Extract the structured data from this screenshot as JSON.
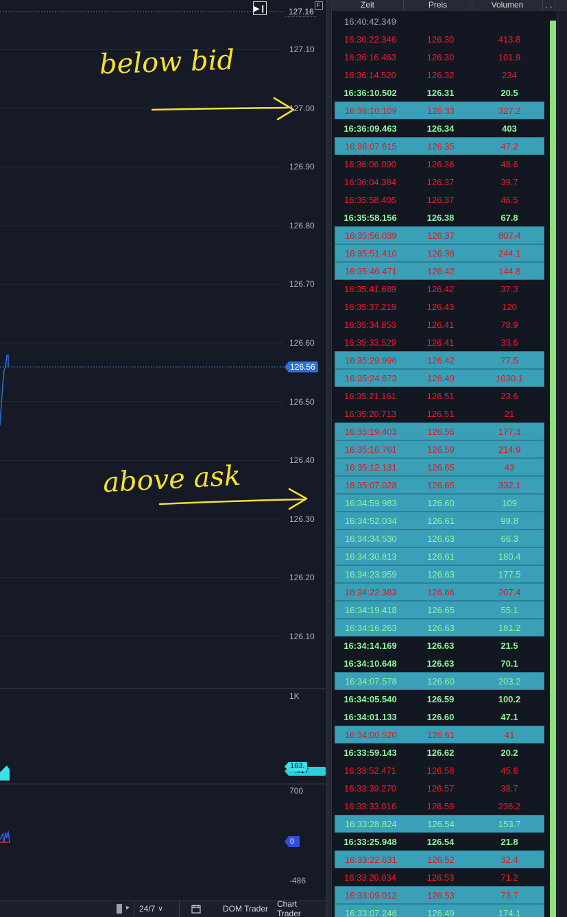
{
  "chart": {
    "price_axis": [
      "127.10",
      "127.00",
      "126.90",
      "126.80",
      "126.70",
      "126.60",
      "126.50",
      "126.40",
      "126.30",
      "126.20",
      "126.10"
    ],
    "high_price": "127.16",
    "last_price": "126.56",
    "indicator_axis": {
      "top": "1K",
      "mid": "700",
      "bottom": "-486"
    },
    "indicator_tag1": "163.",
    "indicator_tag2": ".517",
    "indicator_tag3": "0",
    "annotations": {
      "below_bid": "below bid",
      "above_ask": "above ask"
    },
    "colors": {
      "background": "#151a26",
      "grid": "#262b37",
      "price_line": "#2f6fd8",
      "annotation": "#f5e130"
    }
  },
  "toolbar": {
    "session": "24/7",
    "calendar_icon": "calendar-icon",
    "dom_trader": "DOM Trader",
    "chart_trader": "Chart Trader"
  },
  "tas": {
    "headers": {
      "time": "Zeit",
      "price": "Preis",
      "volume": "Volumen",
      "more": ". ."
    },
    "rows": [
      {
        "t": "16:40:42.349",
        "p": "",
        "v": "",
        "s": "gray"
      },
      {
        "t": "16:36:22.346",
        "p": "126.30",
        "v": "413.8",
        "s": "red"
      },
      {
        "t": "16:36:16.463",
        "p": "126.30",
        "v": "101.9",
        "s": "red"
      },
      {
        "t": "16:36:14.520",
        "p": "126.32",
        "v": "234",
        "s": "red"
      },
      {
        "t": "16:36:10.502",
        "p": "126.31",
        "v": "20.5",
        "s": "gb"
      },
      {
        "t": "16:36:10.109",
        "p": "126.33",
        "v": "327.2",
        "s": "red",
        "hl": true
      },
      {
        "t": "16:36:09.463",
        "p": "126.34",
        "v": "403",
        "s": "gb"
      },
      {
        "t": "16:36:07.615",
        "p": "126.35",
        "v": "47.2",
        "s": "red",
        "hl": true
      },
      {
        "t": "16:36:06.090",
        "p": "126.36",
        "v": "48.6",
        "s": "red"
      },
      {
        "t": "16:36:04.384",
        "p": "126.37",
        "v": "39.7",
        "s": "red"
      },
      {
        "t": "16:35:58.405",
        "p": "126.37",
        "v": "46.5",
        "s": "red"
      },
      {
        "t": "16:35:58.156",
        "p": "126.38",
        "v": "67.8",
        "s": "gb"
      },
      {
        "t": "16:35:56.039",
        "p": "126.37",
        "v": "807.4",
        "s": "red",
        "hl": true
      },
      {
        "t": "16:35:51.410",
        "p": "126.38",
        "v": "244.1",
        "s": "red",
        "hl": true
      },
      {
        "t": "16:35:46.471",
        "p": "126.42",
        "v": "144.8",
        "s": "red",
        "hl": true
      },
      {
        "t": "16:35:41.689",
        "p": "126.42",
        "v": "37.3",
        "s": "red"
      },
      {
        "t": "16:35:37.219",
        "p": "126.43",
        "v": "120",
        "s": "red"
      },
      {
        "t": "16:35:34.853",
        "p": "126.41",
        "v": "78.9",
        "s": "red"
      },
      {
        "t": "16:35:33.529",
        "p": "126.41",
        "v": "33.6",
        "s": "red"
      },
      {
        "t": "16:35:29.996",
        "p": "126.42",
        "v": "77.5",
        "s": "red",
        "hl": true
      },
      {
        "t": "16:35:24.673",
        "p": "126.49",
        "v": "1030.1",
        "s": "red",
        "hl": true
      },
      {
        "t": "16:35:21.161",
        "p": "126.51",
        "v": "23.6",
        "s": "red"
      },
      {
        "t": "16:35:20.713",
        "p": "126.51",
        "v": "21",
        "s": "red"
      },
      {
        "t": "16:35:19.403",
        "p": "126.56",
        "v": "177.3",
        "s": "red",
        "hl": true
      },
      {
        "t": "16:35:16.761",
        "p": "126.59",
        "v": "214.9",
        "s": "red",
        "hl": true
      },
      {
        "t": "16:35:12.131",
        "p": "126.65",
        "v": "43",
        "s": "red",
        "hl": true
      },
      {
        "t": "16:35:07.028",
        "p": "126.65",
        "v": "332.1",
        "s": "red",
        "hl": true
      },
      {
        "t": "16:34:59.983",
        "p": "126.60",
        "v": "109",
        "s": "gn",
        "hl": true
      },
      {
        "t": "16:34:52.034",
        "p": "126.61",
        "v": "99.8",
        "s": "gn",
        "hl": true
      },
      {
        "t": "16:34:34.530",
        "p": "126.63",
        "v": "66.3",
        "s": "gn",
        "hl": true
      },
      {
        "t": "16:34:30.813",
        "p": "126.61",
        "v": "180.4",
        "s": "gn",
        "hl": true
      },
      {
        "t": "16:34:23.959",
        "p": "126.63",
        "v": "177.5",
        "s": "gn",
        "hl": true
      },
      {
        "t": "16:34:22.383",
        "p": "126.66",
        "v": "207.4",
        "s": "red",
        "hl": true
      },
      {
        "t": "16:34:19.418",
        "p": "126.65",
        "v": "55.1",
        "s": "gn",
        "hl": true
      },
      {
        "t": "16:34:16.263",
        "p": "126.63",
        "v": "181.2",
        "s": "gn",
        "hl": true
      },
      {
        "t": "16:34:14.169",
        "p": "126.63",
        "v": "21.5",
        "s": "gb"
      },
      {
        "t": "16:34:10.648",
        "p": "126.63",
        "v": "70.1",
        "s": "gb"
      },
      {
        "t": "16:34:07.578",
        "p": "126.60",
        "v": "203.2",
        "s": "gn",
        "hl": true
      },
      {
        "t": "16:34:05.540",
        "p": "126.59",
        "v": "100.2",
        "s": "gb"
      },
      {
        "t": "16:34:01.133",
        "p": "126.60",
        "v": "47.1",
        "s": "gb"
      },
      {
        "t": "16:34:00.520",
        "p": "126.61",
        "v": "41",
        "s": "red",
        "hl": true
      },
      {
        "t": "16:33:59.143",
        "p": "126.62",
        "v": "20.2",
        "s": "gb"
      },
      {
        "t": "16:33:52.471",
        "p": "126.58",
        "v": "45.6",
        "s": "red"
      },
      {
        "t": "16:33:39.270",
        "p": "126.57",
        "v": "38.7",
        "s": "red"
      },
      {
        "t": "16:33:33.016",
        "p": "126.59",
        "v": "236.2",
        "s": "red"
      },
      {
        "t": "16:33:28.824",
        "p": "126.54",
        "v": "153.7",
        "s": "gn",
        "hl": true
      },
      {
        "t": "16:33:25.948",
        "p": "126.54",
        "v": "21.8",
        "s": "gb"
      },
      {
        "t": "16:33:22.631",
        "p": "126.52",
        "v": "32.4",
        "s": "red",
        "hl": true
      },
      {
        "t": "16:33:20.034",
        "p": "126.53",
        "v": "71.2",
        "s": "red"
      },
      {
        "t": "16:33:09.012",
        "p": "126.53",
        "v": "73.7",
        "s": "red",
        "hl": true
      },
      {
        "t": "16:33:07.246",
        "p": "126.49",
        "v": "174.1",
        "s": "gn",
        "hl": true
      }
    ]
  }
}
